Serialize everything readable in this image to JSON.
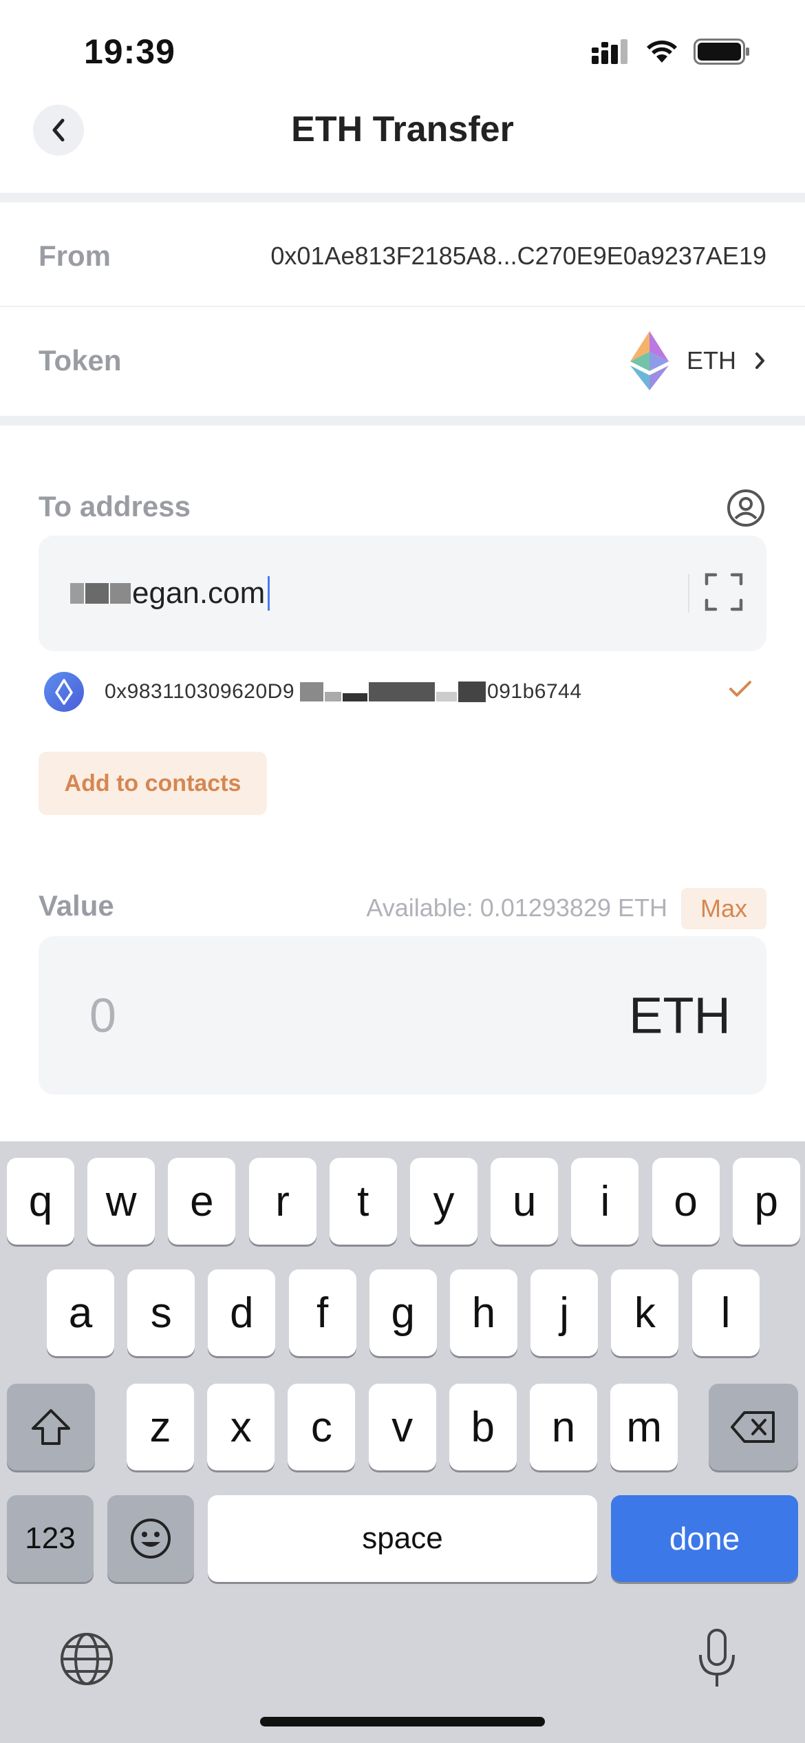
{
  "status_bar": {
    "time": "19:39"
  },
  "nav": {
    "title": "ETH Transfer"
  },
  "from": {
    "label": "From",
    "value": "0x01Ae813F2185A8...C270E9E0a9237AE19"
  },
  "token": {
    "label": "Token",
    "symbol": "ETH"
  },
  "to": {
    "label": "To address",
    "input_prefix": "",
    "input_value": "egan.com",
    "resolved_prefix": "0x983110309620D9",
    "resolved_suffix": "091b6744"
  },
  "add_contacts_label": "Add to contacts",
  "value": {
    "label": "Value",
    "available": "Available: 0.01293829 ETH",
    "max_label": "Max",
    "placeholder": "0",
    "unit": "ETH"
  },
  "keyboard": {
    "row1": [
      "q",
      "w",
      "e",
      "r",
      "t",
      "y",
      "u",
      "i",
      "o",
      "p"
    ],
    "row2": [
      "a",
      "s",
      "d",
      "f",
      "g",
      "h",
      "j",
      "k",
      "l"
    ],
    "row3": [
      "z",
      "x",
      "c",
      "v",
      "b",
      "n",
      "m"
    ],
    "numbers_label": "123",
    "space_label": "space",
    "done_label": "done"
  },
  "colors": {
    "accent": "#d58752",
    "accent_bg": "#fbeee4",
    "done_blue": "#3c78e8"
  }
}
